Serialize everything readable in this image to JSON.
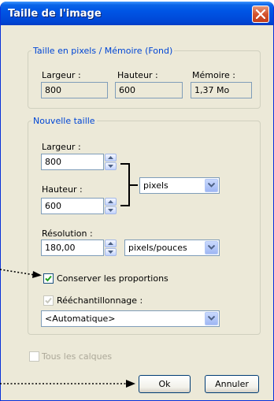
{
  "dialog": {
    "title": "Taille de l'image"
  },
  "current_size": {
    "legend": "Taille en pixels / Mémoire (Fond)",
    "width_label": "Largeur :",
    "width_value": "800",
    "height_label": "Hauteur :",
    "height_value": "600",
    "memory_label": "Mémoire :",
    "memory_value": "1,37 Mo"
  },
  "new_size": {
    "legend": "Nouvelle taille",
    "width_label": "Largeur :",
    "width_value": "800",
    "height_label": "Hauteur :",
    "height_value": "600",
    "unit_selected": "pixels",
    "resolution_label": "Résolution :",
    "resolution_value": "180,00",
    "resolution_unit_selected": "pixels/pouces",
    "keep_proportions_label": "Conserver les proportions",
    "keep_proportions_checked": true,
    "resample_label": "Rééchantillonnage :",
    "resample_checked": true,
    "resample_selected": "<Automatique>"
  },
  "all_layers": {
    "label": "Tous les calques",
    "checked": false
  },
  "buttons": {
    "ok": "Ok",
    "cancel": "Annuler"
  },
  "icons": {
    "close": "close-icon",
    "spin_up": "spin-up-icon",
    "spin_down": "spin-down-icon",
    "dropdown": "chevron-down-icon",
    "checkmark": "checkmark-icon",
    "pointer_dots": "dotted-arrow-icon"
  },
  "colors": {
    "titlebar": "#0055e5",
    "legend": "#0046d5",
    "close_button": "#d4532d",
    "dialog_bg": "#ece9d8"
  }
}
